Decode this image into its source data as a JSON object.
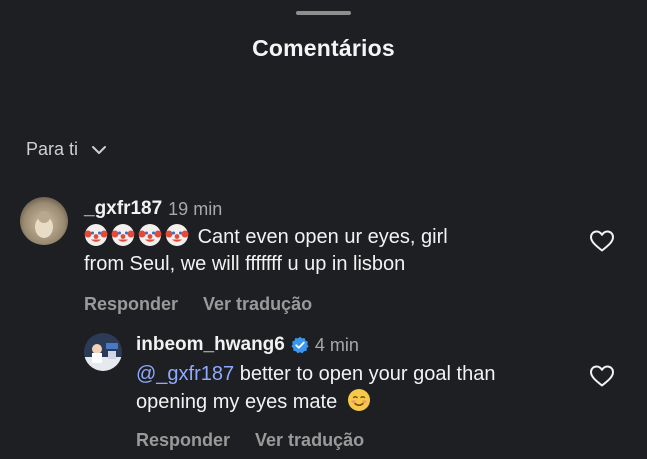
{
  "sheet": {
    "title": "Comentários"
  },
  "sort": {
    "label": "Para ti"
  },
  "comments": [
    {
      "username": "_gxfr187",
      "time": "19 min",
      "emoji_prefix": [
        "clown-face-emoji",
        "clown-face-emoji",
        "clown-face-emoji",
        "clown-face-emoji"
      ],
      "text_line1": "Cant even open ur eyes, girl",
      "text_line2": "from Seul, we will fffffff u up in lisbon",
      "reply_label": "Responder",
      "translate_label": "Ver tradução"
    },
    {
      "username": "inbeom_hwang6",
      "verified": true,
      "time": "4 min",
      "mention": "@_gxfr187",
      "text_line1": " better to open your goal than",
      "text_line2": "opening my eyes mate",
      "emoji_suffix": "smiling-face-emoji",
      "reply_label": "Responder",
      "translate_label": "Ver tradução"
    }
  ],
  "colors": {
    "background": "#1e1f22",
    "mention": "#8fa9ff",
    "verified": "#3897f0",
    "muted": "#a8a8a8"
  }
}
